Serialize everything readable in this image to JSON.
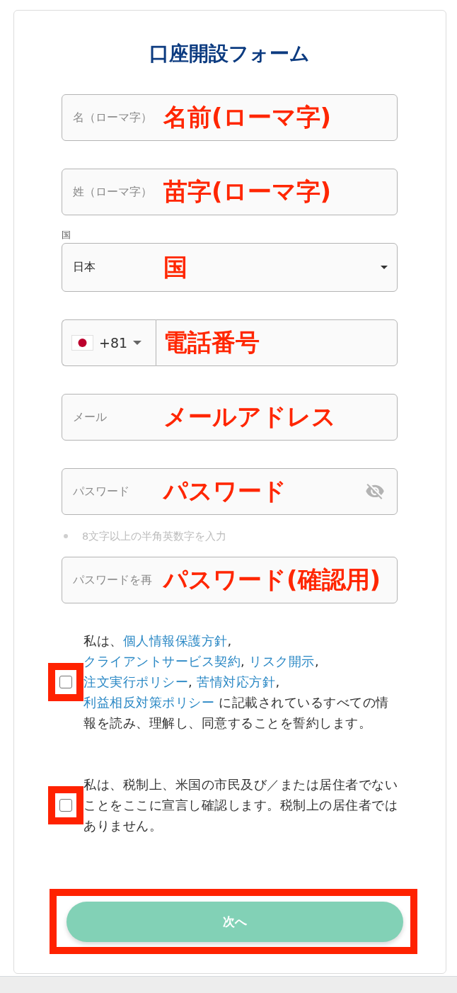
{
  "form": {
    "title": "口座開設フォーム"
  },
  "fields": [
    {
      "kind": "text",
      "placeholder": "名（ローマ字）",
      "annotation": "名前(ローマ字)"
    },
    {
      "kind": "text",
      "placeholder": "姓（ローマ字）",
      "annotation": "苗字(ローマ字)"
    },
    {
      "kind": "select",
      "label": "国",
      "value": "日本",
      "annotation": "国"
    },
    {
      "kind": "phone",
      "country_code": "+81",
      "annotation": "電話番号"
    },
    {
      "kind": "text",
      "placeholder": "メール",
      "annotation": "メールアドレス"
    },
    {
      "kind": "password",
      "placeholder": "パスワード",
      "visibility_toggle": true,
      "annotation": "パスワード",
      "hint": "8文字以上の半角英数字を入力"
    },
    {
      "kind": "password",
      "placeholder": "パスワードを再",
      "visibility_toggle": false,
      "annotation": "パスワード(確認用)"
    }
  ],
  "consents": [
    {
      "checked": false,
      "highlighted": true,
      "parts": [
        {
          "kind": "text",
          "text": "私は、"
        },
        {
          "kind": "link",
          "text": "個人情報保護方針"
        },
        {
          "kind": "text",
          "text": ", "
        },
        {
          "kind": "link",
          "text": "クライアントサービス契約"
        },
        {
          "kind": "text",
          "text": ", "
        },
        {
          "kind": "link",
          "text": "リスク開示"
        },
        {
          "kind": "text",
          "text": ", "
        },
        {
          "kind": "link",
          "text": "注文実行ポリシー"
        },
        {
          "kind": "text",
          "text": ", "
        },
        {
          "kind": "link",
          "text": "苦情対応方針"
        },
        {
          "kind": "text",
          "text": ", "
        },
        {
          "kind": "link",
          "text": "利益相反対策ポリシー"
        },
        {
          "kind": "text",
          "text": " に記載されているすべての情報を読み、理解し、同意することを誓約します。"
        }
      ]
    },
    {
      "checked": false,
      "highlighted": true,
      "parts": [
        {
          "kind": "text",
          "text": "私は、税制上、米国の市民及び／または居住者でないことをここに宣言し確認します。税制上の居住者ではありません。"
        }
      ]
    }
  ],
  "submit": {
    "label": "次へ",
    "disabled": true,
    "highlighted": true
  }
}
